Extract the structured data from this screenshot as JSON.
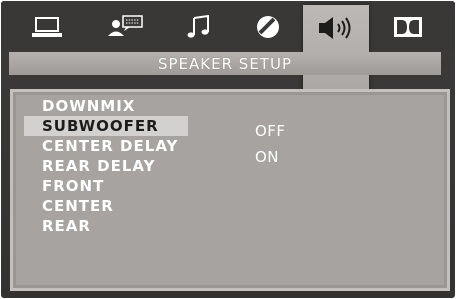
{
  "tabs": [
    {
      "icon": "laptop-icon",
      "active": false
    },
    {
      "icon": "user-speech-icon",
      "active": false
    },
    {
      "icon": "music-note-icon",
      "active": false
    },
    {
      "icon": "slash-circle-icon",
      "active": false
    },
    {
      "icon": "speaker-icon",
      "active": true
    },
    {
      "icon": "dolby-icon",
      "active": false
    }
  ],
  "title": "SPEAKER SETUP",
  "menu": {
    "items": [
      {
        "label": "DOWNMIX",
        "selected": false
      },
      {
        "label": "SUBWOOFER",
        "selected": true
      },
      {
        "label": "CENTER DELAY",
        "selected": false
      },
      {
        "label": "REAR DELAY",
        "selected": false
      },
      {
        "label": "FRONT",
        "selected": false
      },
      {
        "label": "CENTER",
        "selected": false
      },
      {
        "label": "REAR",
        "selected": false
      }
    ]
  },
  "options": [
    {
      "label": "OFF"
    },
    {
      "label": "ON"
    }
  ],
  "colors": {
    "background": "#3a3837",
    "panel": "#a7a3a0",
    "highlight": "#d3d1cf",
    "text": "#ffffff"
  }
}
